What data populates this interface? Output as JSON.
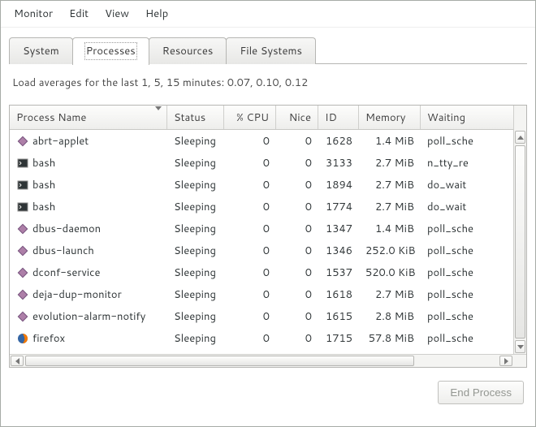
{
  "menubar": [
    "Monitor",
    "Edit",
    "View",
    "Help"
  ],
  "tabs": [
    {
      "label": "System",
      "active": false
    },
    {
      "label": "Processes",
      "active": true
    },
    {
      "label": "Resources",
      "active": false
    },
    {
      "label": "File Systems",
      "active": false
    }
  ],
  "load_avg_text": "Load averages for the last 1, 5, 15 minutes: 0.07, 0.10, 0.12",
  "columns": [
    {
      "key": "name",
      "label": "Process Name",
      "sort": "asc"
    },
    {
      "key": "status",
      "label": "Status"
    },
    {
      "key": "cpu",
      "label": "% CPU"
    },
    {
      "key": "nice",
      "label": "Nice"
    },
    {
      "key": "id",
      "label": "ID"
    },
    {
      "key": "memory",
      "label": "Memory"
    },
    {
      "key": "waiting",
      "label": "Waiting"
    }
  ],
  "processes": [
    {
      "icon": "diamond",
      "name": "abrt-applet",
      "status": "Sleeping",
      "cpu": "0",
      "nice": "0",
      "id": "1628",
      "memory": "1.4 MiB",
      "waiting": "poll_sche"
    },
    {
      "icon": "terminal",
      "name": "bash",
      "status": "Sleeping",
      "cpu": "0",
      "nice": "0",
      "id": "3133",
      "memory": "2.7 MiB",
      "waiting": "n_tty_re"
    },
    {
      "icon": "terminal",
      "name": "bash",
      "status": "Sleeping",
      "cpu": "0",
      "nice": "0",
      "id": "1894",
      "memory": "2.7 MiB",
      "waiting": "do_wait"
    },
    {
      "icon": "terminal",
      "name": "bash",
      "status": "Sleeping",
      "cpu": "0",
      "nice": "0",
      "id": "1774",
      "memory": "2.7 MiB",
      "waiting": "do_wait"
    },
    {
      "icon": "diamond",
      "name": "dbus-daemon",
      "status": "Sleeping",
      "cpu": "0",
      "nice": "0",
      "id": "1347",
      "memory": "1.4 MiB",
      "waiting": "poll_sche"
    },
    {
      "icon": "diamond",
      "name": "dbus-launch",
      "status": "Sleeping",
      "cpu": "0",
      "nice": "0",
      "id": "1346",
      "memory": "252.0 KiB",
      "waiting": "poll_sche"
    },
    {
      "icon": "diamond",
      "name": "dconf-service",
      "status": "Sleeping",
      "cpu": "0",
      "nice": "0",
      "id": "1537",
      "memory": "520.0 KiB",
      "waiting": "poll_sche"
    },
    {
      "icon": "diamond",
      "name": "deja-dup-monitor",
      "status": "Sleeping",
      "cpu": "0",
      "nice": "0",
      "id": "1618",
      "memory": "2.7 MiB",
      "waiting": "poll_sche"
    },
    {
      "icon": "diamond",
      "name": "evolution-alarm-notify",
      "status": "Sleeping",
      "cpu": "0",
      "nice": "0",
      "id": "1615",
      "memory": "2.8 MiB",
      "waiting": "poll_sche"
    },
    {
      "icon": "firefox",
      "name": "firefox",
      "status": "Sleeping",
      "cpu": "0",
      "nice": "0",
      "id": "1715",
      "memory": "57.8 MiB",
      "waiting": "poll_sche"
    }
  ],
  "end_process_label": "End Process"
}
